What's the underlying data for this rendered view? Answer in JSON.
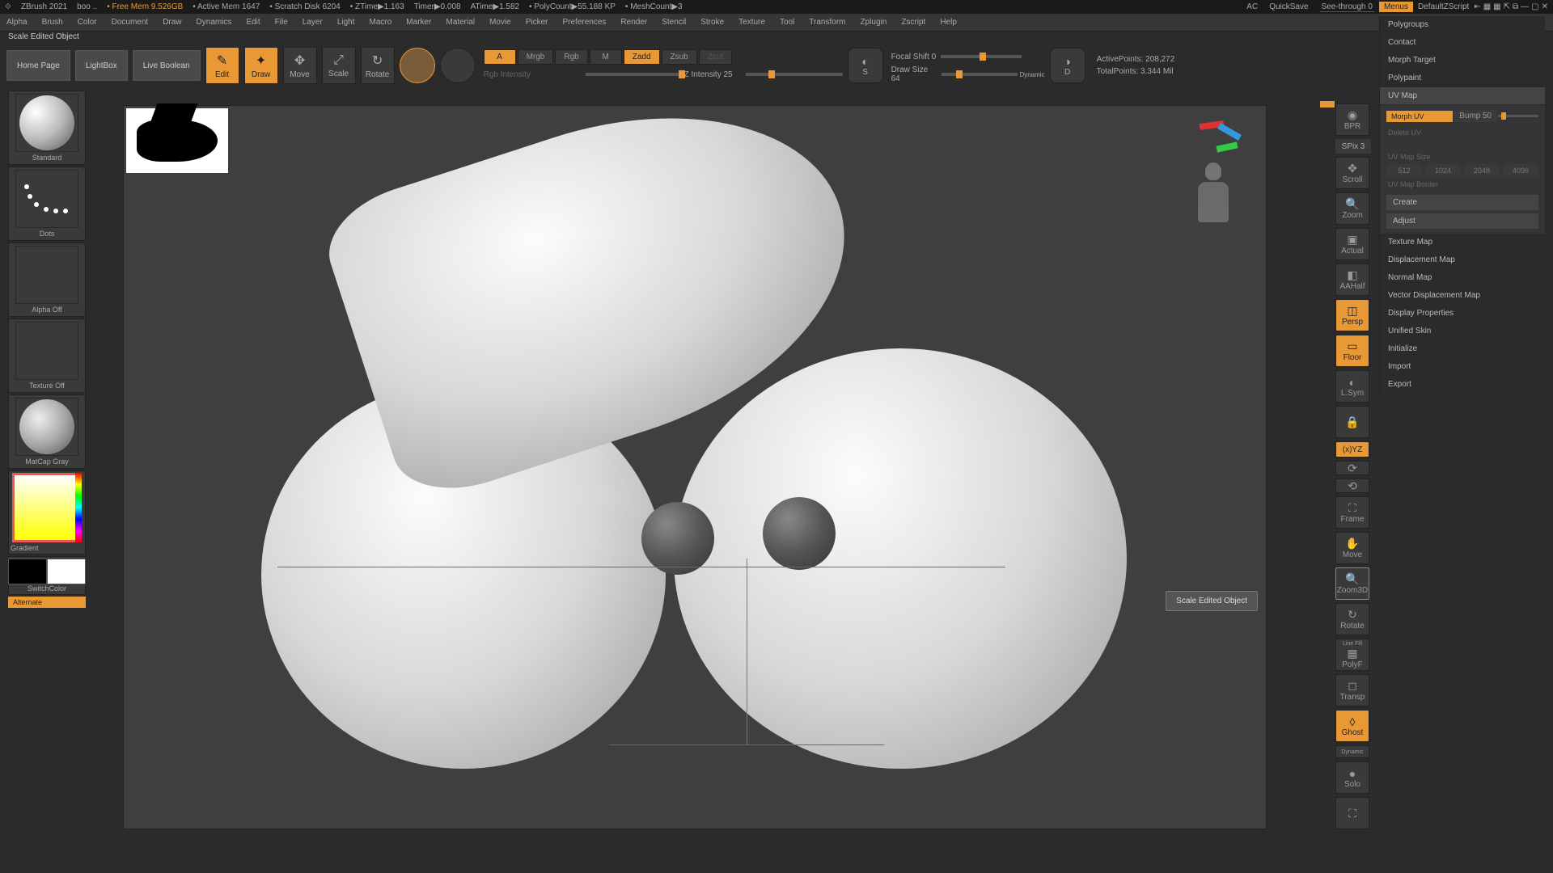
{
  "title": {
    "app": "ZBrush 2021",
    "project": "boo  ..",
    "mem": "Free Mem 9.526GB",
    "activeMem": "Active Mem 1647",
    "scratch": "Scratch Disk 6204",
    "ztime": "ZTime▶1.163",
    "timer": "Timer▶0.008",
    "atime": "ATime▶1.582",
    "polycount": "PolyCount▶55.188 KP",
    "meshcount": "MeshCount▶3",
    "ac": "AC",
    "quicksave": "QuickSave",
    "seethrough": "See-through  0",
    "menus": "Menus",
    "defaultscript": "DefaultZScript"
  },
  "menus": [
    "Alpha",
    "Brush",
    "Color",
    "Document",
    "Draw",
    "Dynamics",
    "Edit",
    "File",
    "Layer",
    "Light",
    "Macro",
    "Marker",
    "Material",
    "Movie",
    "Picker",
    "Preferences",
    "Render",
    "Stencil",
    "Stroke",
    "Texture",
    "Tool",
    "Transform",
    "Zplugin",
    "Zscript",
    "Help"
  ],
  "status": "Scale Edited Object",
  "tabs": {
    "home": "Home Page",
    "lightbox": "LightBox",
    "liveboolean": "Live Boolean"
  },
  "modes": {
    "edit": "Edit",
    "draw": "Draw",
    "move": "Move",
    "scale": "Scale",
    "rotate": "Rotate"
  },
  "sliders": {
    "row1": {
      "a": "A",
      "mrgb": "Mrgb",
      "rgb": "Rgb",
      "m": "M",
      "zadd": "Zadd",
      "zsub": "Zsub",
      "zcut": "Zcut"
    },
    "row2": {
      "rgbint": "Rgb Intensity",
      "zint": "Z Intensity",
      "zintVal": "25"
    },
    "focal": {
      "label": "Focal Shift",
      "val": "0"
    },
    "drawsize": {
      "label": "Draw Size",
      "val": "64",
      "dynamic": "Dynamic"
    },
    "s": "S",
    "d": "D"
  },
  "stats": {
    "active": "ActivePoints: 208,272",
    "total": "TotalPoints: 3.344 Mil"
  },
  "left": {
    "brush": "Standard",
    "stroke": "Dots",
    "alpha": "Alpha Off",
    "texture": "Texture Off",
    "material": "MatCap Gray",
    "gradient": "Gradient",
    "switch": "SwitchColor",
    "alternate": "Alternate"
  },
  "rightdock": {
    "bpr": "BPR",
    "spix": "SPix",
    "spixVal": "3",
    "scroll": "Scroll",
    "zoom": "Zoom",
    "actual": "Actual",
    "aahalf": "AAHalf",
    "persp": "Persp",
    "floor": "Floor",
    "lsym": "L.Sym",
    "xyz": "(x)YZ",
    "frame": "Frame",
    "move": "Move",
    "zoom3d": "Zoom3D",
    "rotate": "Rotate",
    "linefill": "Line Fill",
    "polyf": "PolyF",
    "transp": "Transp",
    "ghost": "Ghost",
    "solo": "Solo",
    "dynamic": "Dynamic"
  },
  "tooltip": "Scale Edited Object",
  "rightpanel": {
    "items_top": [
      "Polygroups",
      "Contact",
      "Morph Target",
      "Polypaint"
    ],
    "uvmap": {
      "label": "UV Map",
      "morph": "Morph UV",
      "bump": "Bump",
      "bumpVal": "50",
      "delete": "Delete UV",
      "mapsize": "UV Map Size",
      "sizes": [
        "512",
        "1024",
        "2048",
        "4096"
      ],
      "border": "UV Map Border",
      "create": "Create",
      "adjust": "Adjust"
    },
    "items_bottom": [
      "Texture Map",
      "Displacement Map",
      "Normal Map",
      "Vector Displacement Map",
      "Display Properties",
      "Unified Skin",
      "Initialize",
      "Import",
      "Export"
    ]
  }
}
